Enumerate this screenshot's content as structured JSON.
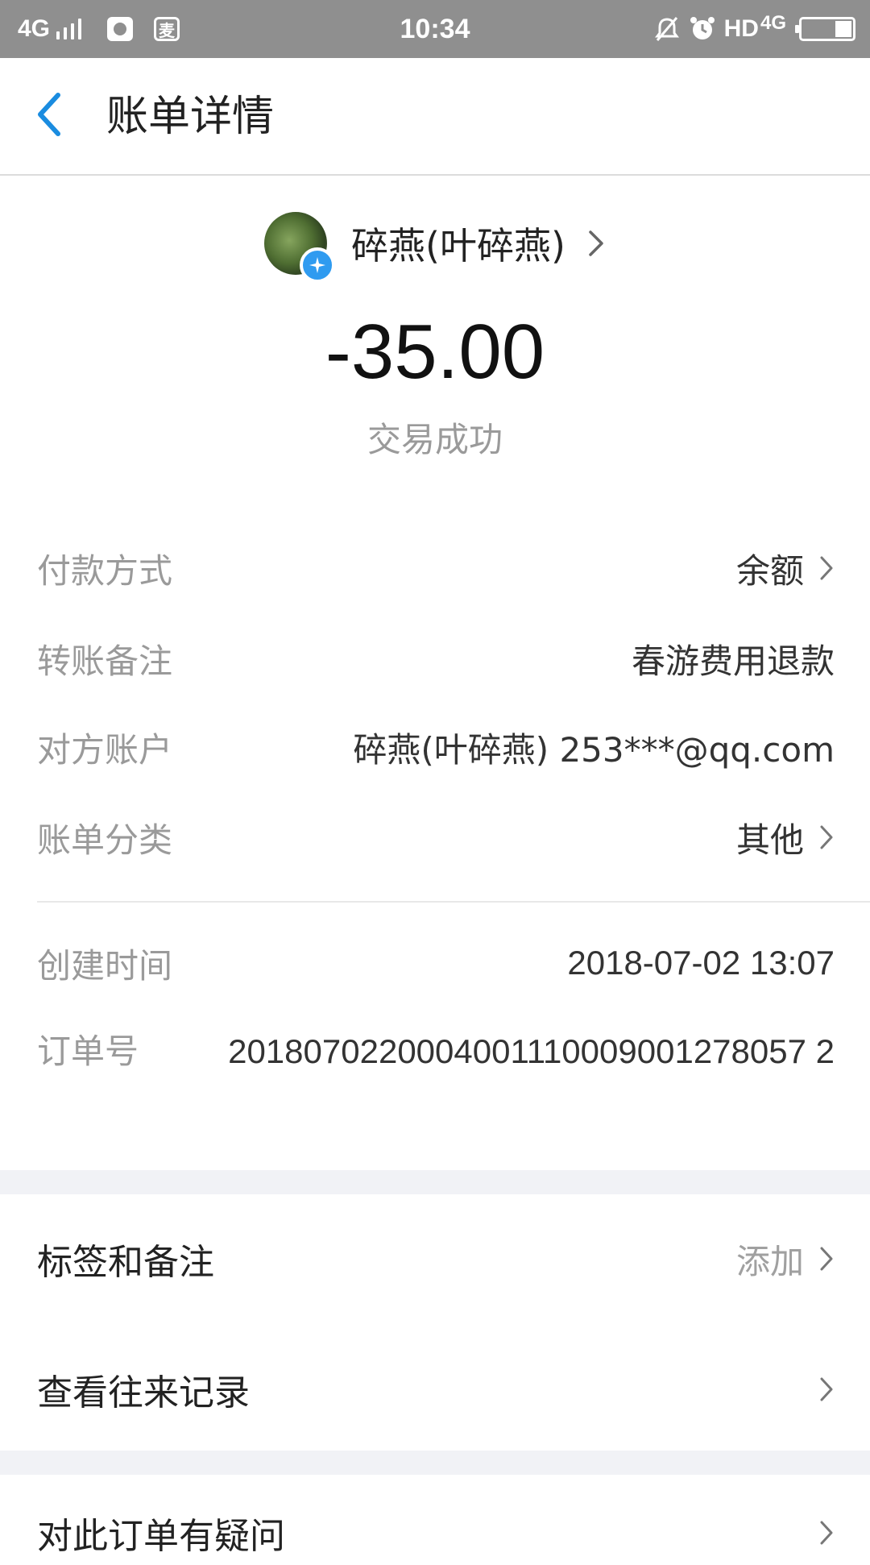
{
  "status_bar": {
    "network": "4G",
    "app_icon_text": "麦",
    "time": "10:34",
    "hd_text": "HD",
    "network_right": "4G"
  },
  "header": {
    "title": "账单详情"
  },
  "payee": {
    "name": "碎燕(叶碎燕)"
  },
  "transaction": {
    "amount": "-35.00",
    "status": "交易成功"
  },
  "details": [
    {
      "label": "付款方式",
      "value": "余额"
    },
    {
      "label": "转账备注",
      "value": "春游费用退款"
    },
    {
      "label": "对方账户",
      "value": "碎燕(叶碎燕) 253***@qq.com"
    },
    {
      "label": "账单分类",
      "value": "其他"
    }
  ],
  "meta": {
    "created_label": "创建时间",
    "created_value": "2018-07-02 13:07",
    "order_label": "订单号",
    "order_value": "2018070220004001110009001278057 2"
  },
  "actions": {
    "tags_label": "标签和备注",
    "tags_value": "添加",
    "history_label": "查看往来记录",
    "dispute_label": "对此订单有疑问"
  },
  "colors": {
    "accent": "#1a8ce0",
    "status_bar": "#8f8f8f",
    "section_gap": "#f1f2f6"
  }
}
